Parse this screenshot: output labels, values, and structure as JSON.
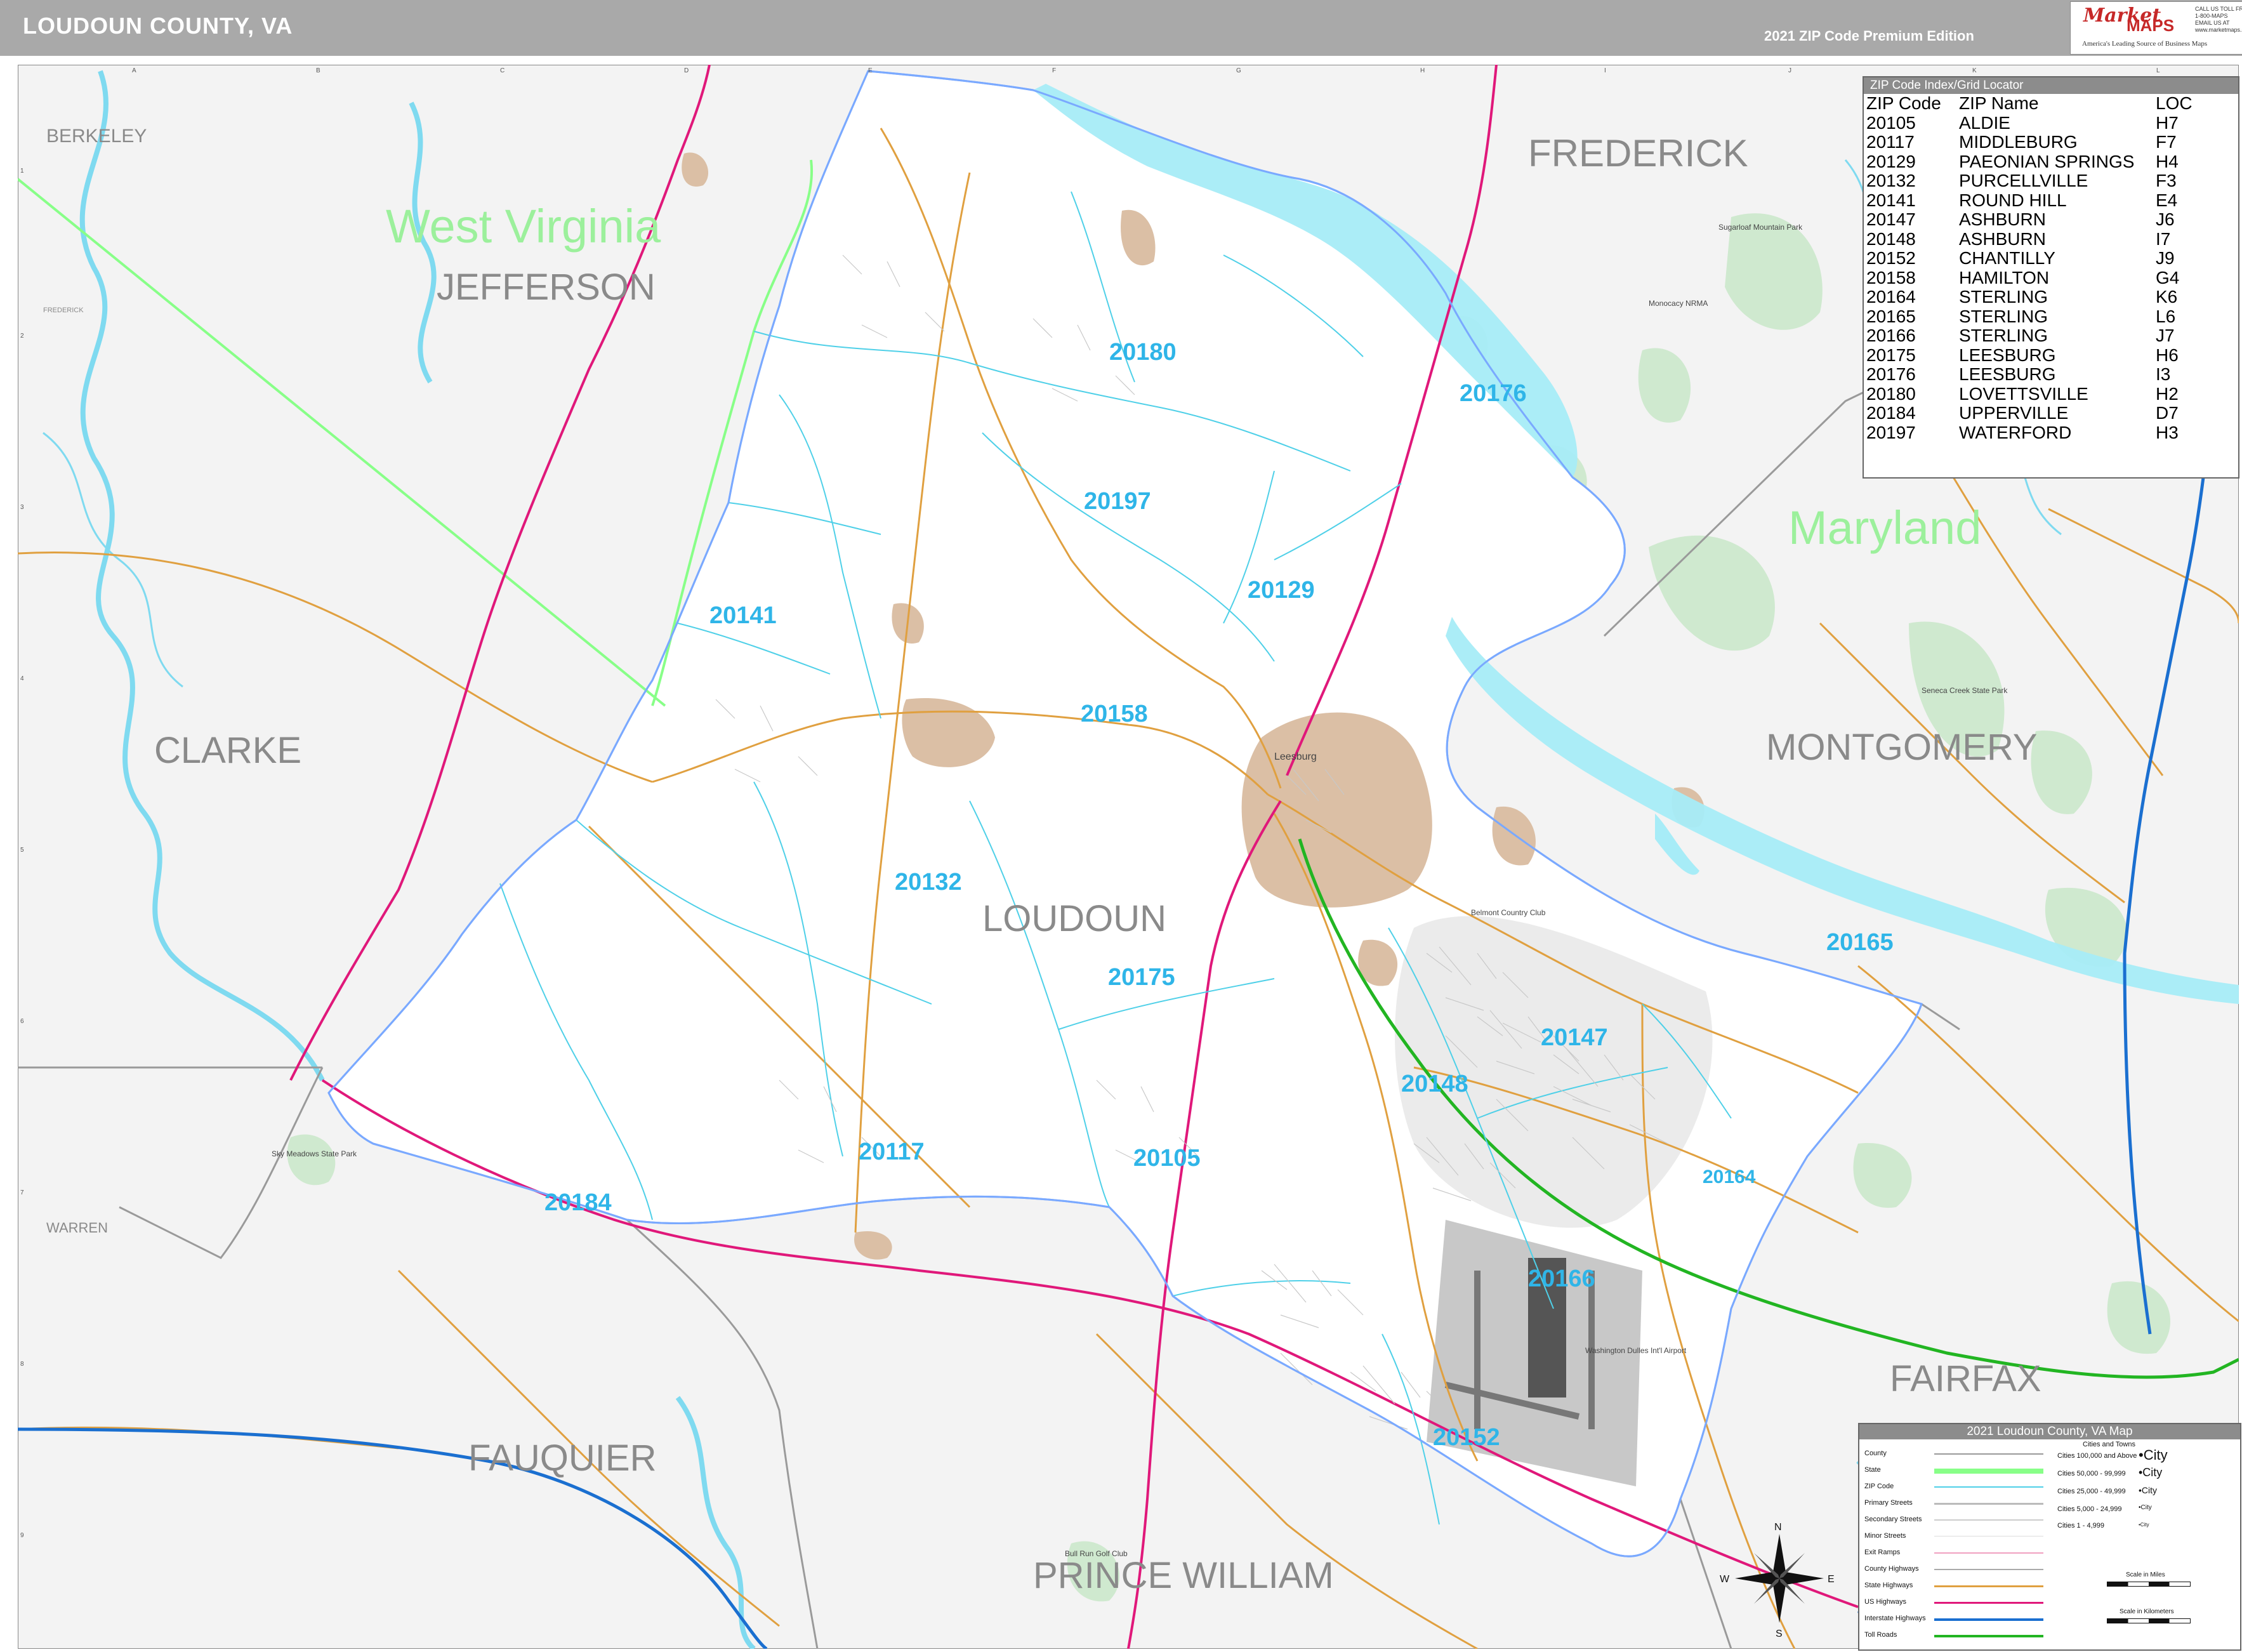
{
  "header": {
    "title": "LOUDOUN COUNTY, VA",
    "edition": "2021 ZIP Code Premium Edition",
    "logo": {
      "market": "Market",
      "maps": "MAPS",
      "tagline": "America's Leading Source of Business Maps",
      "contact_lines": [
        "CALL US TOLL FREE",
        "1-800-MAPS",
        "EMAIL US AT",
        "www.marketmaps.com"
      ]
    }
  },
  "colors": {
    "county_outline": "#7aa9ff",
    "state_line": "#88ff88",
    "zip_line": "#4fd0e8",
    "zip_label": "#2fb5e8",
    "primary_street": "#e0a040",
    "us_highway": "#e0187a",
    "interstate": "#1a6fd0",
    "toll_road": "#22b522",
    "water": "#a7ecf7",
    "park": "#cfe9cf",
    "city_area": "#dbbfa5",
    "outside_fill": "#efefef",
    "title_bar": "#a9a9a9"
  },
  "map": {
    "county_name": "LOUDOUN",
    "region_labels": [
      {
        "name": "FREDERICK",
        "kind": "county"
      },
      {
        "name": "JEFFERSON",
        "kind": "county"
      },
      {
        "name": "West Virginia",
        "kind": "state"
      },
      {
        "name": "Maryland",
        "kind": "state"
      },
      {
        "name": "CLARKE",
        "kind": "county"
      },
      {
        "name": "MONTGOMERY",
        "kind": "county"
      },
      {
        "name": "FAUQUIER",
        "kind": "county"
      },
      {
        "name": "FAIRFAX",
        "kind": "county"
      },
      {
        "name": "PRINCE WILLIAM",
        "kind": "county"
      },
      {
        "name": "BERKELEY",
        "kind": "small-county"
      },
      {
        "name": "WARREN",
        "kind": "small-county"
      },
      {
        "name": "FREDERICK",
        "kind": "tiny-county"
      }
    ],
    "zip_labels": [
      "20180",
      "20176",
      "20197",
      "20129",
      "20141",
      "20158",
      "20132",
      "20175",
      "20165",
      "20147",
      "20148",
      "20117",
      "20105",
      "20184",
      "20164",
      "20166",
      "20152"
    ],
    "place_labels": [
      "Leesburg",
      "Sugarloaf Mountain Park",
      "Monocacy NRMA",
      "Seneca Creek State Park",
      "Belmont Country Club",
      "Washington Dulles Int'l Airport",
      "Bull Run Golf Club",
      "Sky Meadows State Park"
    ],
    "grid_columns": [
      "A",
      "B",
      "C",
      "D",
      "E",
      "F",
      "G",
      "H",
      "I",
      "J",
      "K",
      "L"
    ],
    "grid_rows": [
      "1",
      "2",
      "3",
      "4",
      "5",
      "6",
      "7",
      "8",
      "9"
    ]
  },
  "zip_index": {
    "title": "ZIP Code Index/Grid Locator",
    "columns": [
      "ZIP Code",
      "ZIP Name",
      "LOC"
    ],
    "rows": [
      [
        "20105",
        "ALDIE",
        "H7"
      ],
      [
        "20117",
        "MIDDLEBURG",
        "F7"
      ],
      [
        "20129",
        "PAEONIAN SPRINGS",
        "H4"
      ],
      [
        "20132",
        "PURCELLVILLE",
        "F3"
      ],
      [
        "20141",
        "ROUND HILL",
        "E4"
      ],
      [
        "20147",
        "ASHBURN",
        "J6"
      ],
      [
        "20148",
        "ASHBURN",
        "I7"
      ],
      [
        "20152",
        "CHANTILLY",
        "J9"
      ],
      [
        "20158",
        "HAMILTON",
        "G4"
      ],
      [
        "20164",
        "STERLING",
        "K6"
      ],
      [
        "20165",
        "STERLING",
        "L6"
      ],
      [
        "20166",
        "STERLING",
        "J7"
      ],
      [
        "20175",
        "LEESBURG",
        "H6"
      ],
      [
        "20176",
        "LEESBURG",
        "I3"
      ],
      [
        "20180",
        "LOVETTSVILLE",
        "H2"
      ],
      [
        "20184",
        "UPPERVILLE",
        "D7"
      ],
      [
        "20197",
        "WATERFORD",
        "H3"
      ]
    ]
  },
  "legend": {
    "title": "2021 Loudoun County, VA Map",
    "cities_header": "Cities and Towns",
    "items": [
      "County",
      "State",
      "ZIP Code",
      "Primary Streets",
      "Secondary Streets",
      "Minor Streets",
      "Exit Ramps",
      "County Highways",
      "State Highways",
      "US Highways",
      "Interstate Highways",
      "Toll Roads"
    ],
    "cities": [
      {
        "range": "Cities 100,000 and Above",
        "symbol": "•City"
      },
      {
        "range": "Cities 50,000 - 99,999",
        "symbol": "•City"
      },
      {
        "range": "Cities 25,000 - 49,999",
        "symbol": "•City"
      },
      {
        "range": "Cities 5,000 - 24,999",
        "symbol": "•City"
      },
      {
        "range": "Cities 1 - 4,999",
        "symbol": "•City"
      }
    ],
    "scale_miles": "Scale in Miles",
    "scale_km": "Scale in Kilometers",
    "compass": {
      "n": "N",
      "s": "S",
      "e": "E",
      "w": "W"
    }
  }
}
